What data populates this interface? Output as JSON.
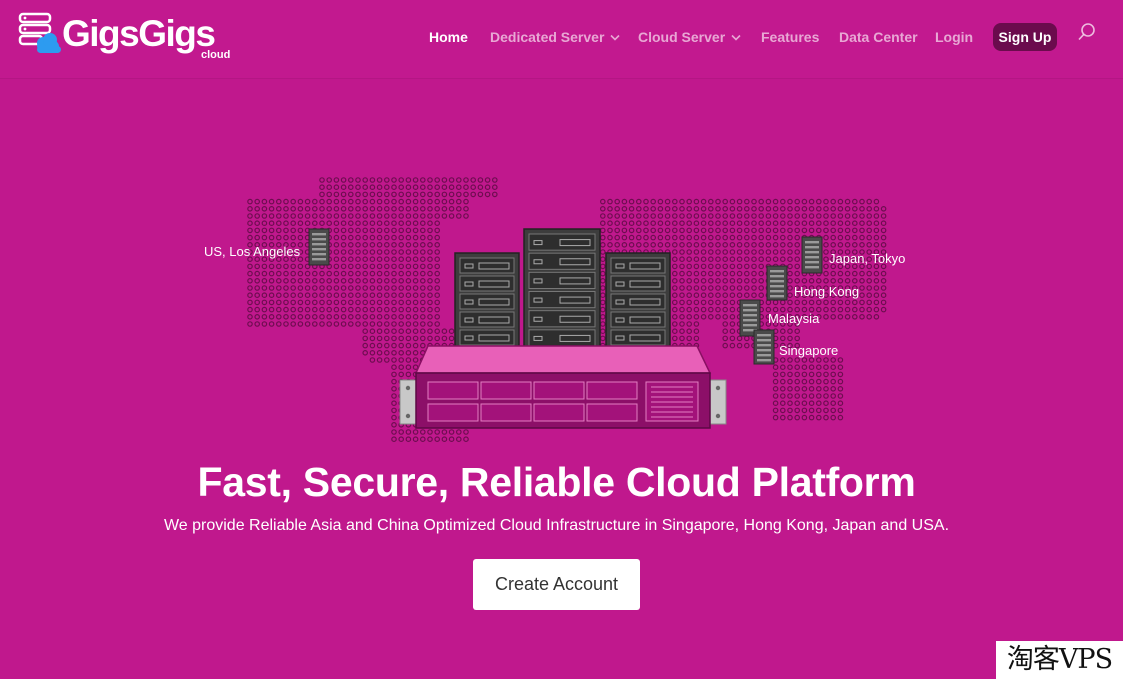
{
  "brand": {
    "name": "GigsGigs",
    "suffix": "cloud",
    "logo_icon": "server-cloud-icon"
  },
  "nav": {
    "items": [
      {
        "label": "Home",
        "active": true,
        "dropdown": false
      },
      {
        "label": "Dedicated Server",
        "active": false,
        "dropdown": true
      },
      {
        "label": "Cloud Server",
        "active": false,
        "dropdown": true
      },
      {
        "label": "Features",
        "active": false,
        "dropdown": false
      },
      {
        "label": "Data Center",
        "active": false,
        "dropdown": false
      },
      {
        "label": "Login",
        "active": false,
        "dropdown": false
      }
    ],
    "signup_label": "Sign Up",
    "search_icon": "search-icon"
  },
  "hero": {
    "locations": [
      {
        "label": "US, Los Angeles"
      },
      {
        "label": "Japan, Tokyo"
      },
      {
        "label": "Hong Kong"
      },
      {
        "label": "Malaysia"
      },
      {
        "label": "Singapore"
      }
    ],
    "headline": "Fast, Secure, Reliable Cloud Platform",
    "subheadline": "We provide Reliable Asia and China Optimized Cloud Infrastructure in Singapore, Hong Kong, Japan and USA.",
    "cta_label": "Create Account"
  },
  "watermark": "淘客VPS",
  "colors": {
    "background": "#c0188d",
    "signup_bg": "#6b0b4d",
    "server_dark": "#4a4a4a",
    "server_pink": "#e860b8",
    "map_dot": "#6e0d50"
  }
}
